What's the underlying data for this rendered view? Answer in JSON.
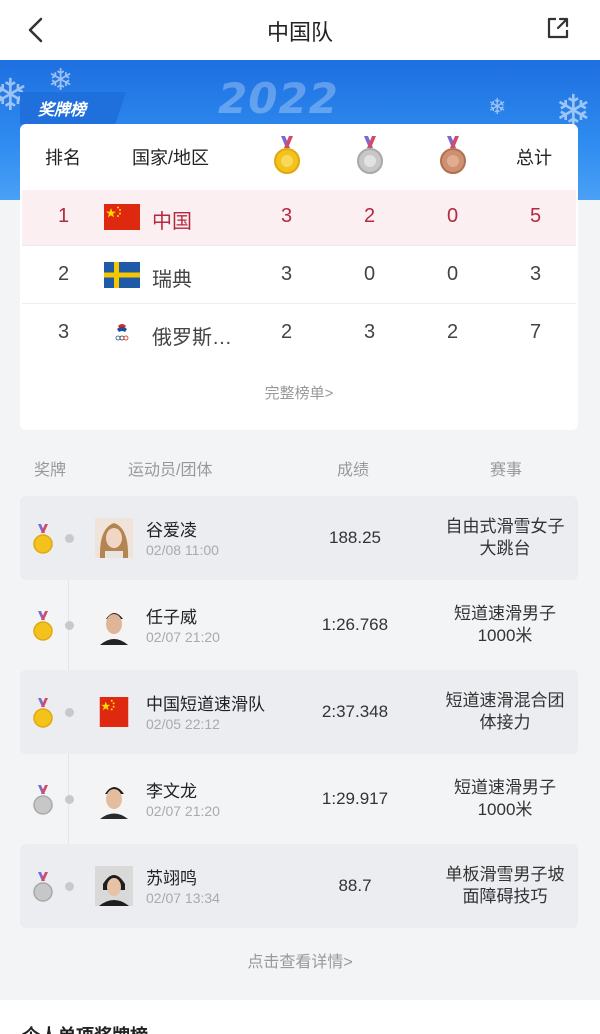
{
  "nav": {
    "title": "中国队",
    "back_icon": "chevron-left-icon",
    "share_icon": "share-icon"
  },
  "banner": {
    "year": "2022",
    "tab_label": "奖牌榜"
  },
  "medal_table": {
    "headers": {
      "rank": "排名",
      "country": "国家/地区",
      "gold": "gold-medal-icon",
      "silver": "silver-medal-icon",
      "bronze": "bronze-medal-icon",
      "total": "总计"
    },
    "rows": [
      {
        "rank": "1",
        "country": "中国",
        "flag": "china-flag",
        "gold": "3",
        "silver": "2",
        "bronze": "0",
        "total": "5"
      },
      {
        "rank": "2",
        "country": "瑞典",
        "flag": "sweden-flag",
        "gold": "3",
        "silver": "0",
        "bronze": "0",
        "total": "3"
      },
      {
        "rank": "3",
        "country": "俄罗斯…",
        "flag": "roc-emblem",
        "gold": "2",
        "silver": "3",
        "bronze": "2",
        "total": "7"
      }
    ],
    "more_link": "完整榜单>"
  },
  "results": {
    "headers": {
      "medal": "奖牌",
      "athlete": "运动员/团体",
      "score": "成绩",
      "event": "赛事"
    },
    "items": [
      {
        "medal": "gold",
        "name": "谷爱凌",
        "time": "02/08 11:00",
        "score": "188.25",
        "event_line1": "自由式滑雪女子",
        "event_line2": "大跳台"
      },
      {
        "medal": "gold",
        "name": "任子威",
        "time": "02/07 21:20",
        "score": "1:26.768",
        "event_line1": "短道速滑男子",
        "event_line2": "1000米"
      },
      {
        "medal": "gold",
        "name": "中国短道速滑队",
        "time": "02/05 22:12",
        "score": "2:37.348",
        "event_line1": "短道速滑混合团",
        "event_line2": "体接力"
      },
      {
        "medal": "silver",
        "name": "李文龙",
        "time": "02/07 21:20",
        "score": "1:29.917",
        "event_line1": "短道速滑男子",
        "event_line2": "1000米"
      },
      {
        "medal": "silver",
        "name": "苏翊鸣",
        "time": "02/07 13:34",
        "score": "88.7",
        "event_line1": "单板滑雪男子坡",
        "event_line2": "面障碍技巧"
      }
    ],
    "detail_link": "点击查看详情>"
  },
  "bottom": {
    "title": "个人单项奖牌榜"
  },
  "colors": {
    "accent": "#1f6fdc",
    "highlight_row": "#fbeff1",
    "highlight_text": "#b3293f",
    "gold": "#e8b417",
    "silver": "#b9b9b9",
    "bronze": "#c98a63"
  }
}
